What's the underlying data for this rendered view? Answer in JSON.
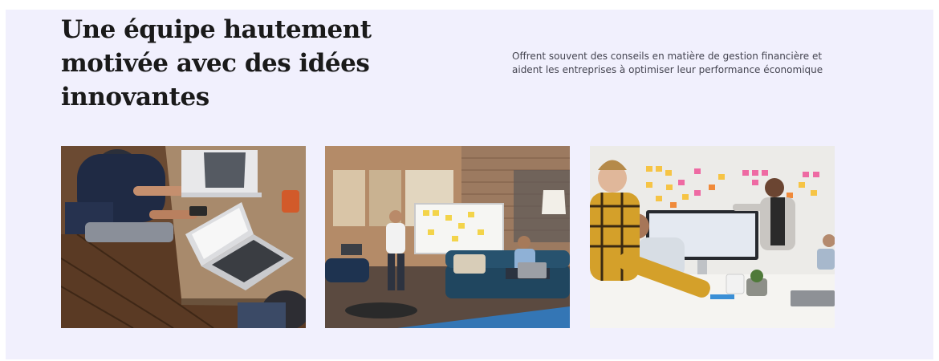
{
  "section": {
    "headline": "Une équipe hautement motivée avec des idées innovantes",
    "intro": "Offrent souvent des conseils en matière de gestion financière et aident les entreprises à optimiser leur performance économique"
  },
  "photos": [
    {
      "subject": "people working on laptops at a wooden desk"
    },
    {
      "subject": "team meeting in front of a whiteboard in a brick-walled office"
    },
    {
      "subject": "colleagues reviewing a screen in front of a sticky-note wall"
    }
  ],
  "colors": {
    "background": "#f1f0fd",
    "headline": "#1a1a1a",
    "body_text": "#444450"
  }
}
